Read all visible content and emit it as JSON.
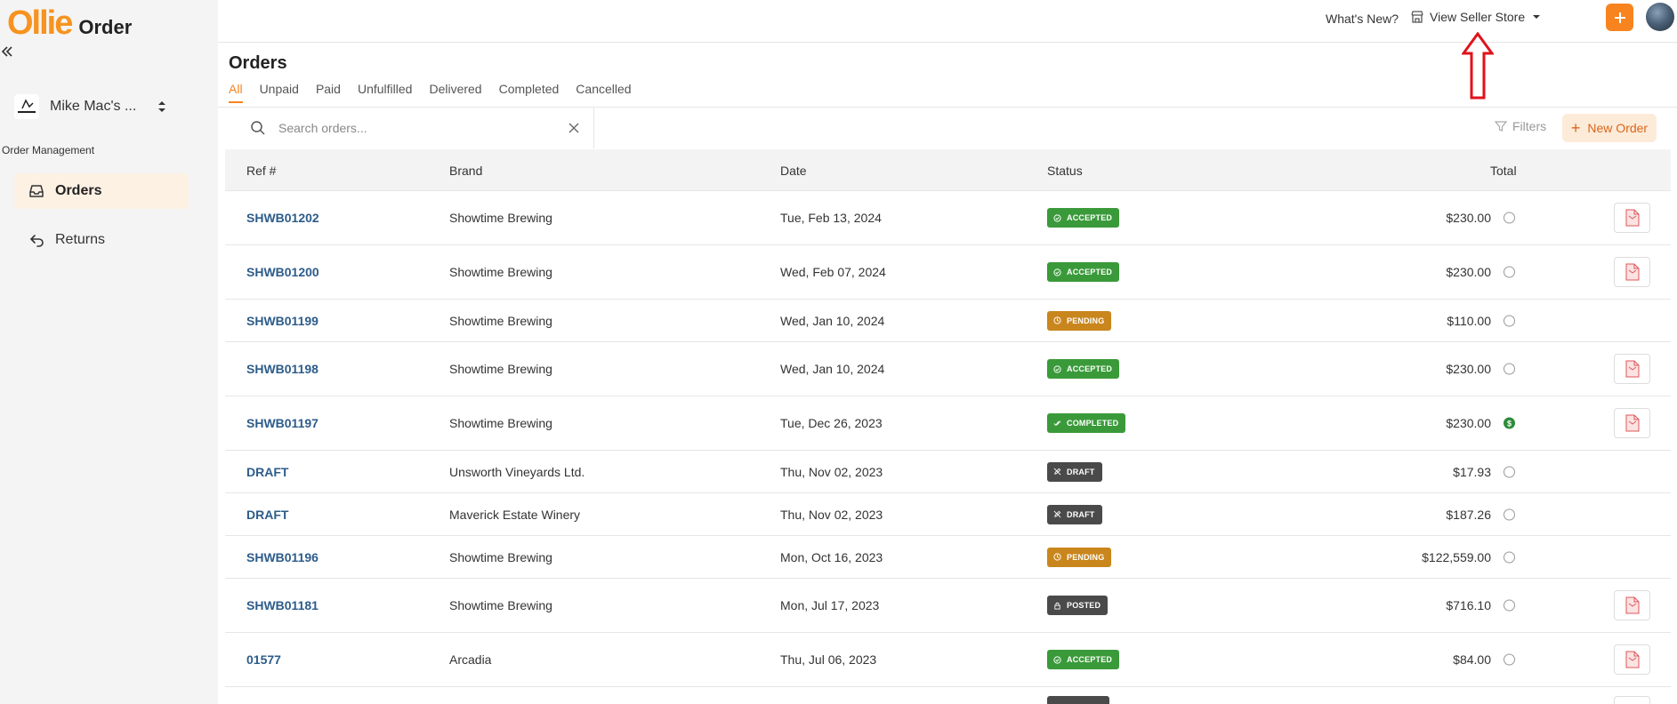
{
  "app": {
    "brand": "Ollie",
    "product": "Order",
    "whats_new": "What's New?",
    "seller_store": "View Seller Store",
    "accent": "#f7841f"
  },
  "sidebar": {
    "account_name": "Mike Mac's ...",
    "section_label": "Order Management",
    "items": [
      {
        "label": "Orders",
        "icon": "inbox-icon",
        "active": true
      },
      {
        "label": "Returns",
        "icon": "return-arrow-icon",
        "active": false
      }
    ]
  },
  "main": {
    "title": "Orders",
    "tabs": [
      "All",
      "Unpaid",
      "Paid",
      "Unfulfilled",
      "Delivered",
      "Completed",
      "Cancelled"
    ],
    "search_placeholder": "Search orders...",
    "filters_label": "Filters",
    "new_order_label": "New Order"
  },
  "table": {
    "columns": [
      "Ref #",
      "Brand",
      "Date",
      "Status",
      "Total"
    ],
    "rows": [
      {
        "ref": "SHWB01202",
        "brand": "Showtime Brewing",
        "date": "Tue, Feb 13, 2024",
        "status": "ACCEPTED",
        "total": "$230.00",
        "paid": false,
        "pdf": true
      },
      {
        "ref": "SHWB01200",
        "brand": "Showtime Brewing",
        "date": "Wed, Feb 07, 2024",
        "status": "ACCEPTED",
        "total": "$230.00",
        "paid": false,
        "pdf": true
      },
      {
        "ref": "SHWB01199",
        "brand": "Showtime Brewing",
        "date": "Wed, Jan 10, 2024",
        "status": "PENDING",
        "total": "$110.00",
        "paid": false,
        "pdf": false
      },
      {
        "ref": "SHWB01198",
        "brand": "Showtime Brewing",
        "date": "Wed, Jan 10, 2024",
        "status": "ACCEPTED",
        "total": "$230.00",
        "paid": false,
        "pdf": true
      },
      {
        "ref": "SHWB01197",
        "brand": "Showtime Brewing",
        "date": "Tue, Dec 26, 2023",
        "status": "COMPLETED",
        "total": "$230.00",
        "paid": true,
        "pdf": true
      },
      {
        "ref": "DRAFT",
        "brand": "Unsworth Vineyards Ltd.",
        "date": "Thu, Nov 02, 2023",
        "status": "DRAFT",
        "total": "$17.93",
        "paid": false,
        "pdf": false
      },
      {
        "ref": "DRAFT",
        "brand": "Maverick Estate Winery",
        "date": "Thu, Nov 02, 2023",
        "status": "DRAFT",
        "total": "$187.26",
        "paid": false,
        "pdf": false
      },
      {
        "ref": "SHWB01196",
        "brand": "Showtime Brewing",
        "date": "Mon, Oct 16, 2023",
        "status": "PENDING",
        "total": "$122,559.00",
        "paid": false,
        "pdf": false
      },
      {
        "ref": "SHWB01181",
        "brand": "Showtime Brewing",
        "date": "Mon, Jul 17, 2023",
        "status": "POSTED",
        "total": "$716.10",
        "paid": false,
        "pdf": true
      },
      {
        "ref": "01577",
        "brand": "Arcadia",
        "date": "Thu, Jul 06, 2023",
        "status": "ACCEPTED",
        "total": "$84.00",
        "paid": false,
        "pdf": true
      }
    ],
    "paid_glyph": "$",
    "pdf_glyph": "PDF"
  }
}
